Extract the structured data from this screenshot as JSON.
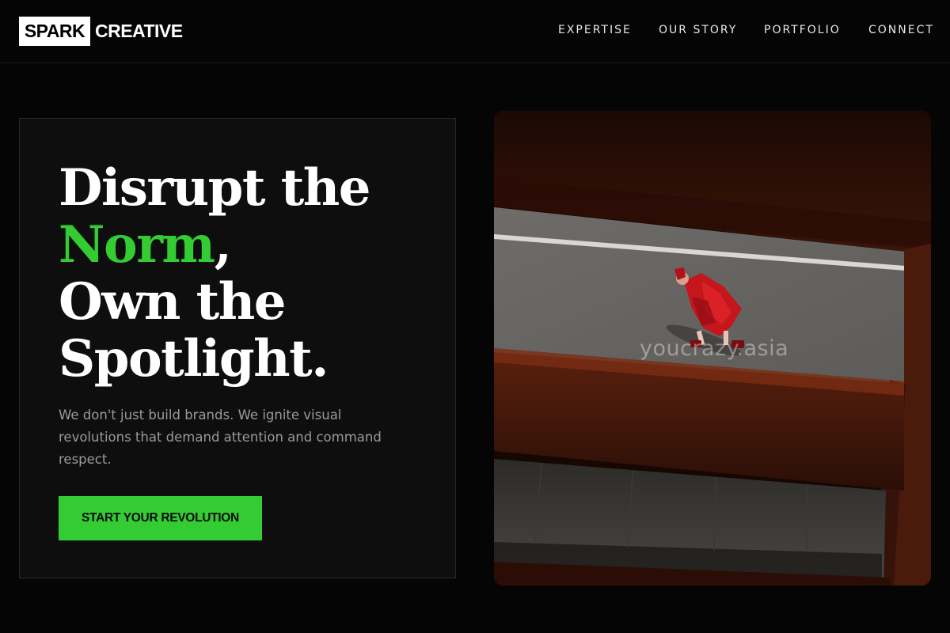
{
  "brand": {
    "logo_box": "SPARK",
    "logo_text": "CREATIVE"
  },
  "nav": {
    "items": [
      {
        "label": "EXPERTISE"
      },
      {
        "label": "OUR STORY"
      },
      {
        "label": "PORTFOLIO"
      },
      {
        "label": "CONNECT"
      }
    ]
  },
  "hero": {
    "headline_line1": "Disrupt the",
    "headline_accent": "Norm",
    "headline_comma": ",",
    "headline_line3": "Own the",
    "headline_line4": "Spotlight.",
    "subtext": "We don't just build brands. We ignite visual revolutions that demand attention and command respect.",
    "cta_label": "START YOUR REVOLUTION"
  },
  "image": {
    "watermark": "youcrazy.asia"
  },
  "colors": {
    "accent": "#33cc33",
    "background": "#050505",
    "card": "#0e0e0e"
  }
}
